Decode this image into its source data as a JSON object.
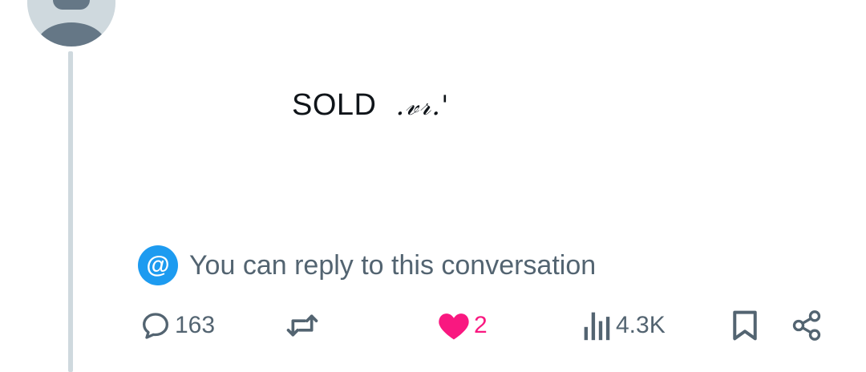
{
  "post": {
    "text": "SOLD",
    "signature": ".𝓋𝓇.'"
  },
  "reply_notice": {
    "icon": "at-icon",
    "icon_glyph": "@",
    "text": "You can reply to this conversation"
  },
  "actions": {
    "replies": {
      "icon": "reply-icon",
      "count": "163"
    },
    "reposts": {
      "icon": "repost-icon",
      "count": ""
    },
    "likes": {
      "icon": "heart-icon",
      "count": "2",
      "liked": true
    },
    "views": {
      "icon": "views-icon",
      "count": "4.3K"
    },
    "bookmark": {
      "icon": "bookmark-icon"
    },
    "share": {
      "icon": "share-icon"
    }
  },
  "colors": {
    "accent": "#1d9bf0",
    "like": "#f91880",
    "muted": "#536471",
    "thread_line": "#cfd9de"
  }
}
